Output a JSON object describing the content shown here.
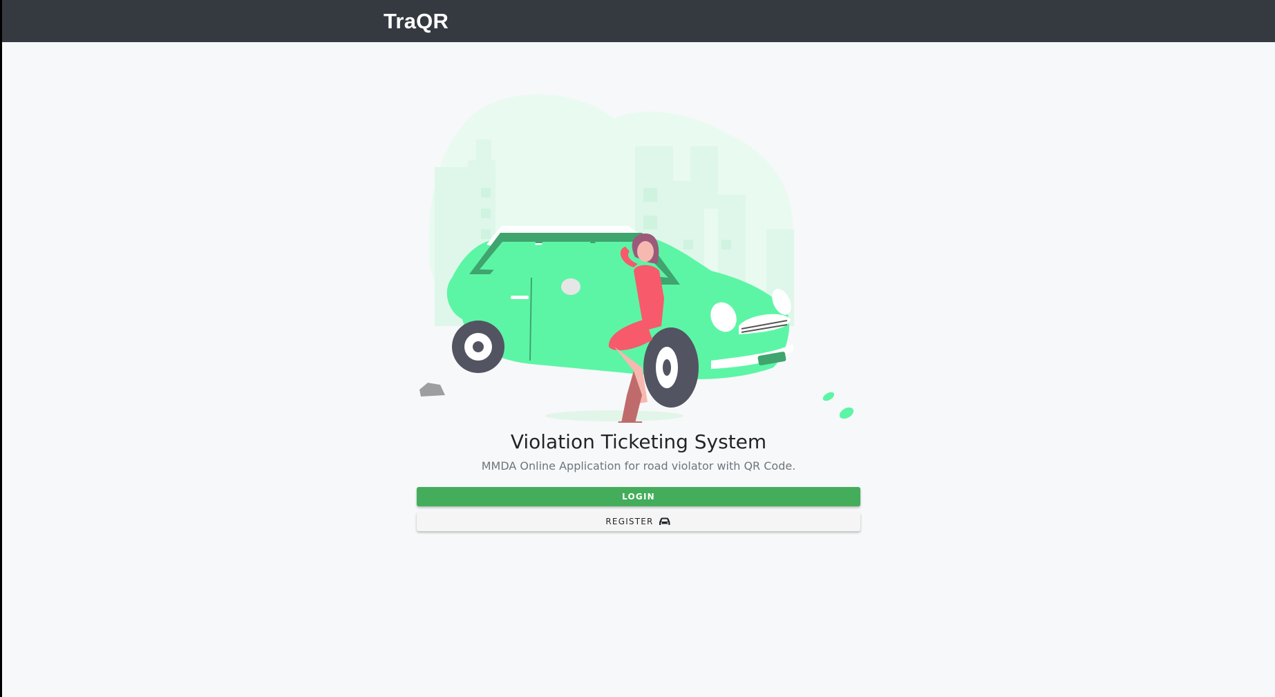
{
  "navbar": {
    "brand": "TraQR"
  },
  "hero": {
    "illustration": "woman-leaning-on-green-car-illustration",
    "title": "Violation Ticketing System",
    "subtitle": "MMDA Online Application for road violator with QR Code."
  },
  "actions": {
    "login_label": "LOGIN",
    "register_label": "REGISTER",
    "register_icon": "car-icon"
  },
  "colors": {
    "navbar_bg": "#343a40",
    "page_bg": "#f7f8f9",
    "login_bg": "#44ad5b",
    "register_bg": "#f5f5f5",
    "car_green": "#5cf5a6"
  }
}
